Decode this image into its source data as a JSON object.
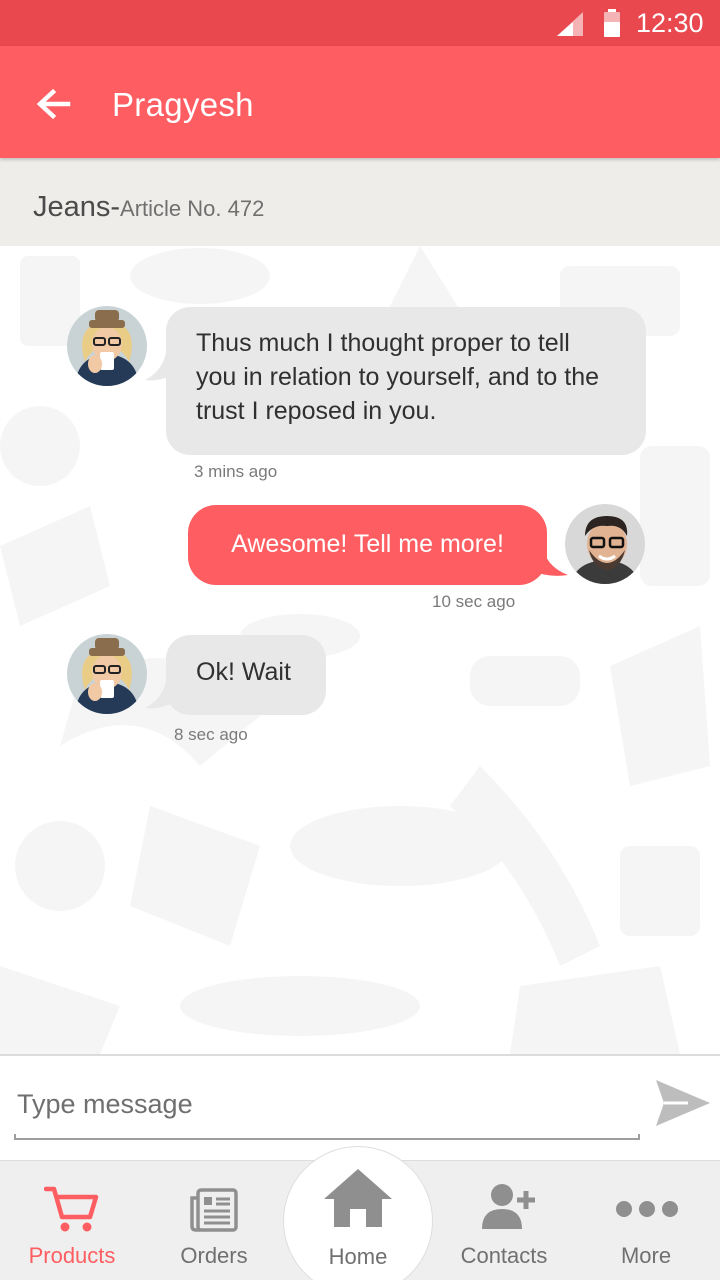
{
  "status_bar": {
    "time": "12:30"
  },
  "header": {
    "title": "Pragyesh",
    "back_icon": "arrow-back-icon"
  },
  "product": {
    "name": "Jeans-",
    "article": "Article No. 472"
  },
  "messages": [
    {
      "direction": "incoming",
      "text_lines": [
        "Thus much I thought proper to tell",
        "you in relation to yourself, and to the",
        "trust I reposed in you."
      ],
      "time": "3 mins ago"
    },
    {
      "direction": "outgoing",
      "text": "Awesome! Tell me more!",
      "time": "10 sec ago"
    },
    {
      "direction": "incoming",
      "text": "Ok! Wait",
      "time": "8 sec ago"
    }
  ],
  "composer": {
    "placeholder": "Type message",
    "send_icon": "send-icon"
  },
  "nav": {
    "items": [
      {
        "label": "Products",
        "icon": "cart-icon",
        "active": true
      },
      {
        "label": "Orders",
        "icon": "orders-icon"
      },
      {
        "label": "Home",
        "icon": "home-icon"
      },
      {
        "label": "Contacts",
        "icon": "add-contact-icon"
      },
      {
        "label": "More",
        "icon": "more-dots-icon"
      }
    ]
  },
  "colors": {
    "accent": "#fe5e62",
    "status_bar": "#e8484e",
    "incoming_bubble": "#e8e8e8",
    "subheader_bg": "#efedea"
  }
}
